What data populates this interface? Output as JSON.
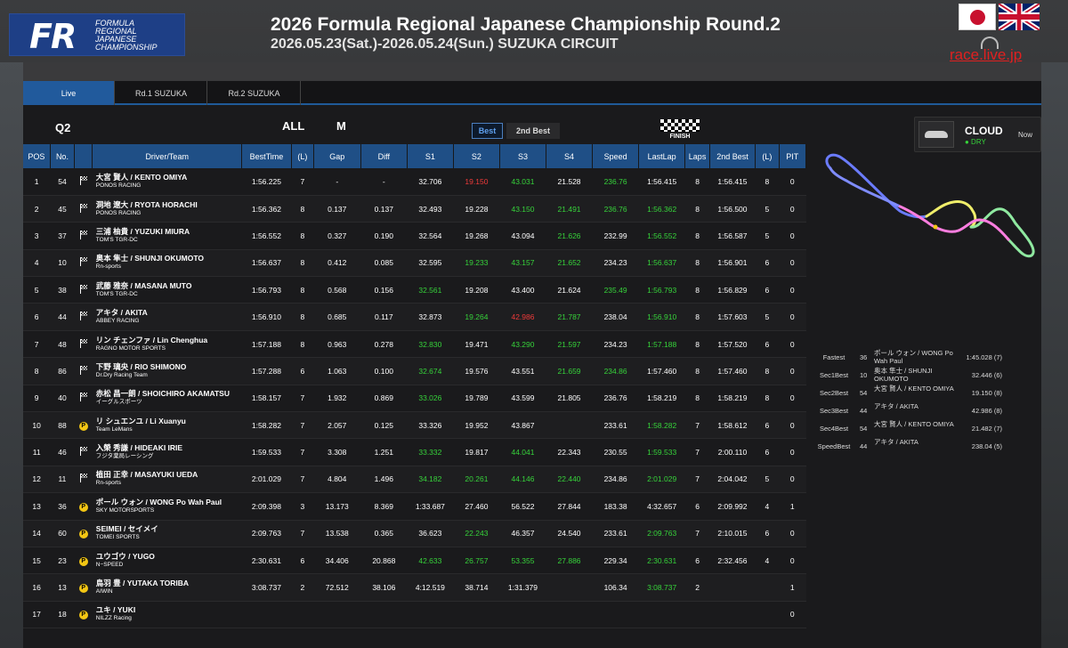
{
  "header": {
    "title": "2026 Formula Regional Japanese Championship Round.2",
    "subtitle": "2026.05.23(Sat.)-2026.05.24(Sun.) SUZUKA CIRCUIT",
    "logo_mark": "FR",
    "logo_lines": [
      "FORMULA",
      "REGIONAL",
      "JAPANESE",
      "CHAMPIONSHIP"
    ],
    "livesite": "race.live.jp"
  },
  "tabs": [
    {
      "label": "Live"
    },
    {
      "label": "Rd.1 SUZUKA"
    },
    {
      "label": "Rd.2 SUZUKA"
    }
  ],
  "session": {
    "name": "Q2",
    "class_all": "ALL",
    "class_m": "M",
    "best_label": "Best",
    "second_best_label": "2nd Best",
    "finish_label": "FINISH"
  },
  "columns": [
    "POS",
    "No.",
    "",
    "Driver/Team",
    "BestTime",
    "(L)",
    "Gap",
    "Diff",
    "S1",
    "S2",
    "S3",
    "S4",
    "Speed",
    "LastLap",
    "Laps",
    "2nd Best",
    "(L)",
    "PIT"
  ],
  "rows": [
    {
      "pos": "1",
      "no": "54",
      "icon": "flag",
      "driver": "大宮 賢人 / KENTO OMIYA",
      "team": "PONOS RACING",
      "best": "1:56.225",
      "l": "7",
      "gap": "-",
      "diff": "-",
      "s1": "32.706",
      "s2": "19.150",
      "s3": "43.031",
      "s4": "21.528",
      "speed": "236.76",
      "last": "1:56.415",
      "laps": "8",
      "second": "1:56.415",
      "l2": "8",
      "pit": "0",
      "c": {
        "s2": "r",
        "s3": "g",
        "speed": "g"
      }
    },
    {
      "pos": "2",
      "no": "45",
      "icon": "flag",
      "driver": "洞地 遼大 / RYOTA HORACHI",
      "team": "PONOS RACING",
      "best": "1:56.362",
      "l": "8",
      "gap": "0.137",
      "diff": "0.137",
      "s1": "32.493",
      "s2": "19.228",
      "s3": "43.150",
      "s4": "21.491",
      "speed": "236.76",
      "last": "1:56.362",
      "laps": "8",
      "second": "1:56.500",
      "l2": "5",
      "pit": "0",
      "c": {
        "s3": "g",
        "s4": "g",
        "speed": "g",
        "last": "g"
      }
    },
    {
      "pos": "3",
      "no": "37",
      "icon": "flag",
      "driver": "三浦 柚貴 / YUZUKI MIURA",
      "team": "TOM'S TGR-DC",
      "best": "1:56.552",
      "l": "8",
      "gap": "0.327",
      "diff": "0.190",
      "s1": "32.564",
      "s2": "19.268",
      "s3": "43.094",
      "s4": "21.626",
      "speed": "232.99",
      "last": "1:56.552",
      "laps": "8",
      "second": "1:56.587",
      "l2": "5",
      "pit": "0",
      "c": {
        "s4": "g",
        "last": "g"
      }
    },
    {
      "pos": "4",
      "no": "10",
      "icon": "flag",
      "driver": "奥本 隼士 / SHUNJI OKUMOTO",
      "team": "Rn-sports",
      "best": "1:56.637",
      "l": "8",
      "gap": "0.412",
      "diff": "0.085",
      "s1": "32.595",
      "s2": "19.233",
      "s3": "43.157",
      "s4": "21.652",
      "speed": "234.23",
      "last": "1:56.637",
      "laps": "8",
      "second": "1:56.901",
      "l2": "6",
      "pit": "0",
      "c": {
        "s2": "g",
        "s3": "g",
        "s4": "g",
        "last": "g"
      }
    },
    {
      "pos": "5",
      "no": "38",
      "icon": "flag",
      "driver": "武藤 雅奈 / MASANA MUTO",
      "team": "TOM'S TGR-DC",
      "best": "1:56.793",
      "l": "8",
      "gap": "0.568",
      "diff": "0.156",
      "s1": "32.561",
      "s2": "19.208",
      "s3": "43.400",
      "s4": "21.624",
      "speed": "235.49",
      "last": "1:56.793",
      "laps": "8",
      "second": "1:56.829",
      "l2": "6",
      "pit": "0",
      "c": {
        "s1": "g",
        "speed": "g",
        "last": "g"
      }
    },
    {
      "pos": "6",
      "no": "44",
      "icon": "flag",
      "driver": "アキタ / AKITA",
      "team": "ABBEY RACING",
      "best": "1:56.910",
      "l": "8",
      "gap": "0.685",
      "diff": "0.117",
      "s1": "32.873",
      "s2": "19.264",
      "s3": "42.986",
      "s4": "21.787",
      "speed": "238.04",
      "last": "1:56.910",
      "laps": "8",
      "second": "1:57.603",
      "l2": "5",
      "pit": "0",
      "c": {
        "s2": "g",
        "s3": "r",
        "s4": "g",
        "last": "g"
      }
    },
    {
      "pos": "7",
      "no": "48",
      "icon": "flag",
      "driver": "リン チェンファ / Lin Chenghua",
      "team": "RAGNO MOTOR SPORTS",
      "best": "1:57.188",
      "l": "8",
      "gap": "0.963",
      "diff": "0.278",
      "s1": "32.830",
      "s2": "19.471",
      "s3": "43.290",
      "s4": "21.597",
      "speed": "234.23",
      "last": "1:57.188",
      "laps": "8",
      "second": "1:57.520",
      "l2": "6",
      "pit": "0",
      "c": {
        "s1": "g",
        "s3": "g",
        "s4": "g",
        "last": "g"
      }
    },
    {
      "pos": "8",
      "no": "86",
      "icon": "flag",
      "driver": "下野 璃央 / RIO SHIMONO",
      "team": "Dr.Dry Racing Team",
      "best": "1:57.288",
      "l": "6",
      "gap": "1.063",
      "diff": "0.100",
      "s1": "32.674",
      "s2": "19.576",
      "s3": "43.551",
      "s4": "21.659",
      "speed": "234.86",
      "last": "1:57.460",
      "laps": "8",
      "second": "1:57.460",
      "l2": "8",
      "pit": "0",
      "c": {
        "s1": "g",
        "s4": "g",
        "speed": "g"
      }
    },
    {
      "pos": "9",
      "no": "40",
      "icon": "flag",
      "driver": "赤松 昌一朗 / SHOICHIRO AKAMATSU",
      "team": "イーグルスポーツ",
      "best": "1:58.157",
      "l": "7",
      "gap": "1.932",
      "diff": "0.869",
      "s1": "33.026",
      "s2": "19.789",
      "s3": "43.599",
      "s4": "21.805",
      "speed": "236.76",
      "last": "1:58.219",
      "laps": "8",
      "second": "1:58.219",
      "l2": "8",
      "pit": "0",
      "c": {
        "s1": "g"
      }
    },
    {
      "pos": "10",
      "no": "88",
      "icon": "pit",
      "driver": "リ シュエンユ / Li Xuanyu",
      "team": "Team LeMans",
      "best": "1:58.282",
      "l": "7",
      "gap": "2.057",
      "diff": "0.125",
      "s1": "33.326",
      "s2": "19.952",
      "s3": "43.867",
      "s4": "",
      "speed": "233.61",
      "last": "1:58.282",
      "laps": "7",
      "second": "1:58.612",
      "l2": "6",
      "pit": "0",
      "c": {
        "last": "g"
      }
    },
    {
      "pos": "11",
      "no": "46",
      "icon": "flag",
      "driver": "入榮 秀謙 / HIDEAKI IRIE",
      "team": "フジタ薬局レーシング",
      "best": "1:59.533",
      "l": "7",
      "gap": "3.308",
      "diff": "1.251",
      "s1": "33.332",
      "s2": "19.817",
      "s3": "44.041",
      "s4": "22.343",
      "speed": "230.55",
      "last": "1:59.533",
      "laps": "7",
      "second": "2:00.110",
      "l2": "6",
      "pit": "0",
      "c": {
        "s1": "g",
        "s3": "g",
        "last": "g"
      }
    },
    {
      "pos": "12",
      "no": "11",
      "icon": "flag",
      "driver": "植田 正幸 / MASAYUKI UEDA",
      "team": "Rn-sports",
      "best": "2:01.029",
      "l": "7",
      "gap": "4.804",
      "diff": "1.496",
      "s1": "34.182",
      "s2": "20.261",
      "s3": "44.146",
      "s4": "22.440",
      "speed": "234.86",
      "last": "2:01.029",
      "laps": "7",
      "second": "2:04.042",
      "l2": "5",
      "pit": "0",
      "c": {
        "s1": "g",
        "s2": "g",
        "s3": "g",
        "s4": "g",
        "last": "g"
      }
    },
    {
      "pos": "13",
      "no": "36",
      "icon": "pit",
      "driver": "ポール ウォン / WONG Po Wah Paul",
      "team": "SKY MOTORSPORTS",
      "best": "2:09.398",
      "l": "3",
      "gap": "13.173",
      "diff": "8.369",
      "s1": "1:33.687",
      "s2": "27.460",
      "s3": "56.522",
      "s4": "27.844",
      "speed": "183.38",
      "last": "4:32.657",
      "laps": "6",
      "second": "2:09.992",
      "l2": "4",
      "pit": "1",
      "c": {}
    },
    {
      "pos": "14",
      "no": "60",
      "icon": "pit",
      "driver": "SEIMEI / セイメイ",
      "team": "TOMEI SPORTS",
      "best": "2:09.763",
      "l": "7",
      "gap": "13.538",
      "diff": "0.365",
      "s1": "36.623",
      "s2": "22.243",
      "s3": "46.357",
      "s4": "24.540",
      "speed": "233.61",
      "last": "2:09.763",
      "laps": "7",
      "second": "2:10.015",
      "l2": "6",
      "pit": "0",
      "c": {
        "s2": "g",
        "last": "g"
      }
    },
    {
      "pos": "15",
      "no": "23",
      "icon": "pit",
      "driver": "ユウゴウ / YUGO",
      "team": "N−SPEED",
      "best": "2:30.631",
      "l": "6",
      "gap": "34.406",
      "diff": "20.868",
      "s1": "42.633",
      "s2": "26.757",
      "s3": "53.355",
      "s4": "27.886",
      "speed": "229.34",
      "last": "2:30.631",
      "laps": "6",
      "second": "2:32.456",
      "l2": "4",
      "pit": "0",
      "c": {
        "s1": "g",
        "s2": "g",
        "s3": "g",
        "s4": "g",
        "last": "g"
      }
    },
    {
      "pos": "16",
      "no": "13",
      "icon": "pit",
      "driver": "鳥羽 豊 / YUTAKA TORIBA",
      "team": "AIWIN",
      "best": "3:08.737",
      "l": "2",
      "gap": "72.512",
      "diff": "38.106",
      "s1": "4:12.519",
      "s2": "38.714",
      "s3": "1:31.379",
      "s4": "",
      "speed": "106.34",
      "last": "3:08.737",
      "laps": "2",
      "second": "",
      "l2": "",
      "pit": "1",
      "c": {
        "last": "g"
      }
    },
    {
      "pos": "17",
      "no": "18",
      "icon": "pit",
      "driver": "ユキ / YUKI",
      "team": "NILZZ Racing",
      "best": "",
      "l": "",
      "gap": "",
      "diff": "",
      "s1": "",
      "s2": "",
      "s3": "",
      "s4": "",
      "speed": "",
      "last": "",
      "laps": "",
      "second": "",
      "l2": "",
      "pit": "0",
      "c": {}
    }
  ],
  "weather": {
    "condition": "CLOUD",
    "track": "● DRY",
    "when": "Now"
  },
  "bests": [
    {
      "label": "Fastest",
      "no": "36",
      "name": "ポール ウォン / WONG Po Wah Paul",
      "time": "1:45.028 (7)"
    },
    {
      "label": "Sec1Best",
      "no": "10",
      "name": "奥本 隼士 / SHUNJI OKUMOTO",
      "time": "32.446 (6)"
    },
    {
      "label": "Sec2Best",
      "no": "54",
      "name": "大宮 賢人 / KENTO OMIYA",
      "time": "19.150 (8)"
    },
    {
      "label": "Sec3Best",
      "no": "44",
      "name": "アキタ / AKITA",
      "time": "42.986 (8)"
    },
    {
      "label": "Sec4Best",
      "no": "54",
      "name": "大宮 賢人 / KENTO OMIYA",
      "time": "21.482 (7)"
    },
    {
      "label": "SpeedBest",
      "no": "44",
      "name": "アキタ / AKITA",
      "time": "238.04 (5)"
    }
  ],
  "colors": {
    "accent": "#215a9c",
    "green": "#36d33a",
    "red": "#f03a3a",
    "pit": "#f3c614"
  }
}
